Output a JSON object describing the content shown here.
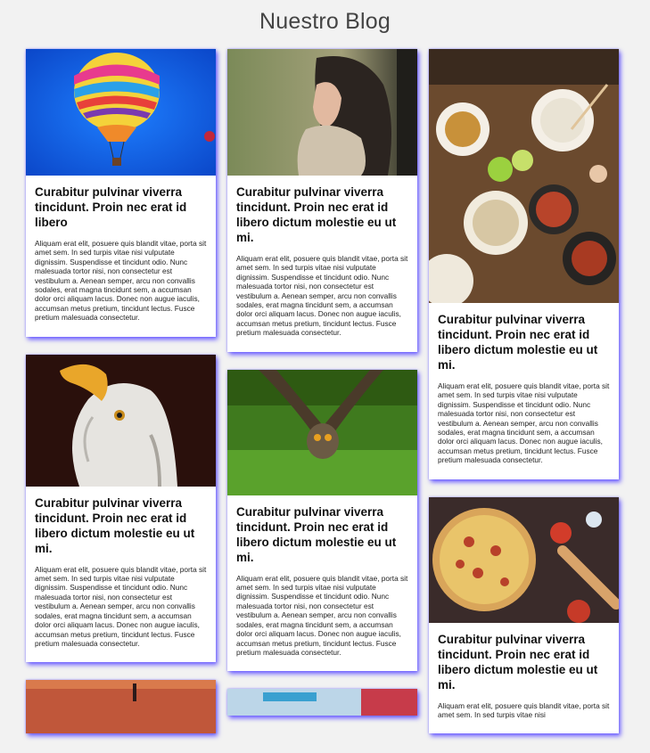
{
  "page": {
    "title": "Nuestro Blog"
  },
  "posts": [
    {
      "title": "Curabitur pulvinar viverra tincidunt. Proin nec erat id libero",
      "text": "Aliquam erat elit, posuere quis blandit vitae, porta sit amet sem. In sed turpis vitae nisi vulputate dignissim. Suspendisse et tincidunt odio. Nunc malesuada tortor nisi, non consectetur est vestibulum a. Aenean semper, arcu non convallis sodales, erat magna tincidunt sem, a accumsan dolor orci aliquam lacus. Donec non augue iaculis, accumsan metus pretium, tincidunt lectus. Fusce pretium malesuada consectetur.",
      "image": "hot-air-balloon"
    },
    {
      "title": "Curabitur pulvinar viverra tincidunt. Proin nec erat id libero dictum molestie eu ut mi.",
      "text": "Aliquam erat elit, posuere quis blandit vitae, porta sit amet sem. In sed turpis vitae nisi vulputate dignissim. Suspendisse et tincidunt odio. Nunc malesuada tortor nisi, non consectetur est vestibulum a. Aenean semper, arcu non convallis sodales, erat magna tincidunt sem, a accumsan dolor orci aliquam lacus. Donec non augue iaculis, accumsan metus pretium, tincidunt lectus. Fusce pretium malesuada consectetur.",
      "image": "woman-portrait"
    },
    {
      "title": "Curabitur pulvinar viverra tincidunt. Proin nec erat id libero dictum molestie eu ut mi.",
      "text": "Aliquam erat elit, posuere quis blandit vitae, porta sit amet sem. In sed turpis vitae nisi vulputate dignissim. Suspendisse et tincidunt odio. Nunc malesuada tortor nisi, non consectetur est vestibulum a. Aenean semper, arcu non convallis sodales, erat magna tincidunt sem, a accumsan dolor orci aliquam lacus. Donec non augue iaculis, accumsan metus pretium, tincidunt lectus. Fusce pretium malesuada consectetur.",
      "image": "food-table"
    },
    {
      "title": "Curabitur pulvinar viverra tincidunt. Proin nec erat id libero dictum molestie eu ut mi.",
      "text": "Aliquam erat elit, posuere quis blandit vitae, porta sit amet sem. In sed turpis vitae nisi vulputate dignissim. Suspendisse et tincidunt odio. Nunc malesuada tortor nisi, non consectetur est vestibulum a. Aenean semper, arcu non convallis sodales, erat magna tincidunt sem, a accumsan dolor orci aliquam lacus. Donec non augue iaculis, accumsan metus pretium, tincidunt lectus. Fusce pretium malesuada consectetur.",
      "image": "eagle"
    },
    {
      "title": "Curabitur pulvinar viverra tincidunt. Proin nec erat id libero dictum molestie eu ut mi.",
      "text": "Aliquam erat elit, posuere quis blandit vitae, porta sit amet sem. In sed turpis vitae nisi vulputate dignissim. Suspendisse et tincidunt odio. Nunc malesuada tortor nisi, non consectetur est vestibulum a. Aenean semper, arcu non convallis sodales, erat magna tincidunt sem, a accumsan dolor orci aliquam lacus. Donec non augue iaculis, accumsan metus pretium, tincidunt lectus. Fusce pretium malesuada consectetur.",
      "image": "owl-flying"
    },
    {
      "title": "Curabitur pulvinar viverra tincidunt. Proin nec erat id libero dictum molestie eu ut mi.",
      "text": "Aliquam erat elit, posuere quis blandit vitae, porta sit amet sem. In sed turpis vitae nisi",
      "image": "pizza"
    }
  ]
}
